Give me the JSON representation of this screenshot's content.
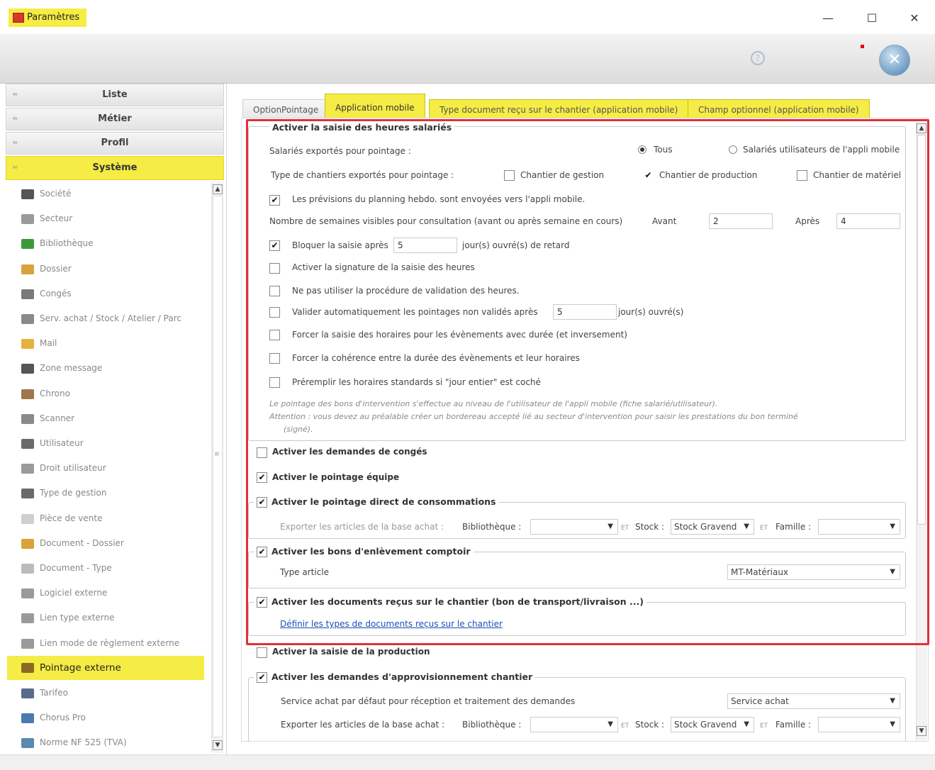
{
  "window": {
    "title": "Paramètres",
    "minimize": "—",
    "maximize": "☐",
    "close": "✕"
  },
  "toolbar": {
    "help_icon": "?",
    "close_icon": "✕"
  },
  "sidebar": {
    "sections": [
      {
        "label": "Liste",
        "chev": "≈"
      },
      {
        "label": "Métier",
        "chev": "≈"
      },
      {
        "label": "Profil",
        "chev": "≈"
      },
      {
        "label": "Système",
        "chev": "≈"
      }
    ],
    "items": [
      {
        "label": "Société",
        "color": "#555"
      },
      {
        "label": "Secteur",
        "color": "#9a9a9a"
      },
      {
        "label": "Bibliothèque",
        "color": "#3a9a3a"
      },
      {
        "label": "Dossier",
        "color": "#d9a23a"
      },
      {
        "label": "Congés",
        "color": "#7a7a7a"
      },
      {
        "label": "Serv. achat / Stock / Atelier / Parc",
        "color": "#8a8a8a"
      },
      {
        "label": "Mail",
        "color": "#e8b040"
      },
      {
        "label": "Zone message",
        "color": "#555"
      },
      {
        "label": "Chrono",
        "color": "#a0764a"
      },
      {
        "label": "Scanner",
        "color": "#8a8a8a"
      },
      {
        "label": "Utilisateur",
        "color": "#6a6a6a"
      },
      {
        "label": "Droit utilisateur",
        "color": "#9a9a9a"
      },
      {
        "label": "Type de gestion",
        "color": "#6a6a6a"
      },
      {
        "label": "Pièce de vente",
        "color": "#cfcfcf"
      },
      {
        "label": "Document - Dossier",
        "color": "#d9a23a"
      },
      {
        "label": "Document - Type",
        "color": "#bbbbbb"
      },
      {
        "label": "Logiciel externe",
        "color": "#9a9a9a"
      },
      {
        "label": "Lien type externe",
        "color": "#9a9a9a"
      },
      {
        "label": "Lien mode de règlement externe",
        "color": "#9a9a9a"
      },
      {
        "label": "Pointage externe",
        "color": "#8a6a20"
      },
      {
        "label": "Tarifeo",
        "color": "#5a6a8a"
      },
      {
        "label": "Chorus Pro",
        "color": "#4a7ab0"
      },
      {
        "label": "Norme NF 525 (TVA)",
        "color": "#5a8ab0"
      }
    ]
  },
  "tabs": [
    {
      "label": "OptionPointage"
    },
    {
      "label": "Application mobile"
    },
    {
      "label": "Type document reçu sur le chantier (application mobile)"
    },
    {
      "label": "Champ optionnel (application mobile)"
    }
  ],
  "form": {
    "saisie_heures": {
      "legend": "Activer la saisie des heures salariés",
      "salaries_label": "Salariés exportés pour pointage :",
      "radio_tous": "Tous",
      "radio_utilisateurs": "Salariés utilisateurs de l'appli mobile",
      "type_chantiers_label": "Type de chantiers exportés pour pointage :",
      "chantier_gestion": "Chantier de gestion",
      "chantier_production": "Chantier de production",
      "chantier_materiel": "Chantier de matériel",
      "previsions": "Les prévisions du planning hebdo. sont envoyées vers l'appli mobile.",
      "nb_semaines_label": "Nombre de semaines visibles pour consultation (avant ou après semaine en cours)",
      "avant_label": "Avant",
      "avant_value": "2",
      "apres_label": "Après",
      "apres_value": "4",
      "bloquer_label": "Bloquer la saisie après",
      "bloquer_value": "5",
      "bloquer_suffix": "jour(s) ouvré(s) de retard",
      "signature": "Activer la signature de la saisie des heures",
      "ne_pas_valider": "Ne pas utiliser la procédure de validation des heures.",
      "valider_auto_label": "Valider automatiquement les pointages non validés après",
      "valider_auto_value": "5",
      "valider_auto_suffix": "jour(s) ouvré(s)",
      "forcer_saisie": "Forcer la saisie des horaires pour les évènements avec durée (et inversement)",
      "forcer_coherence": "Forcer la cohérence entre la durée des évènements et leur horaires",
      "preremplir": "Préremplir les horaires standards si \"jour entier\" est coché",
      "note1": "Le pointage des bons d'intervention s'effectue au niveau de l'utilisateur de l'appli mobile (fiche salarié/utilisateur).",
      "note2": "Attention : vous devez au préalable créer un bordereau accepté lié au secteur d'intervention pour saisir les prestations du bon terminé",
      "note3": "(signé)."
    },
    "conges": "Activer les demandes de congés",
    "pointage_equipe": "Activer le pointage équipe",
    "consommations": {
      "legend": "Activer le pointage direct de consommations",
      "exporter_label": "Exporter les articles de la base achat :",
      "biblio_label": "Bibliothèque :",
      "biblio_value": "",
      "et1": "ET",
      "stock_label": "Stock :",
      "stock_value": "Stock Gravend",
      "et2": "ET",
      "famille_label": "Famille :",
      "famille_value": ""
    },
    "enlevement": {
      "legend": "Activer les bons d'enlèvement comptoir",
      "type_label": "Type article",
      "type_value": "MT-Matériaux"
    },
    "documents": {
      "legend": "Activer les documents reçus sur le chantier (bon de transport/livraison ...)",
      "link": "Définir les types de documents reçus sur le chantier"
    },
    "production": "Activer la saisie de la production",
    "approvisionnement": {
      "legend": "Activer les demandes d'approvisionnement chantier",
      "service_label": "Service achat par défaut pour réception et traitement des demandes",
      "service_value": "Service achat",
      "exporter_label": "Exporter les articles de la base achat :",
      "biblio_label": "Bibliothèque :",
      "biblio_value": "",
      "et1": "ET",
      "stock_label": "Stock :",
      "stock_value": "Stock Gravend",
      "et2": "ET",
      "famille_label": "Famille :",
      "famille_value": ""
    }
  },
  "symbols": {
    "check": "✔",
    "arrow_down": "▼",
    "scroll_up": "▲",
    "scroll_down": "▼",
    "grip": "≡"
  },
  "colors": {
    "accent_yellow": "#f5ec45",
    "highlight_red": "#e0303a",
    "link_blue": "#1a4fb3"
  }
}
